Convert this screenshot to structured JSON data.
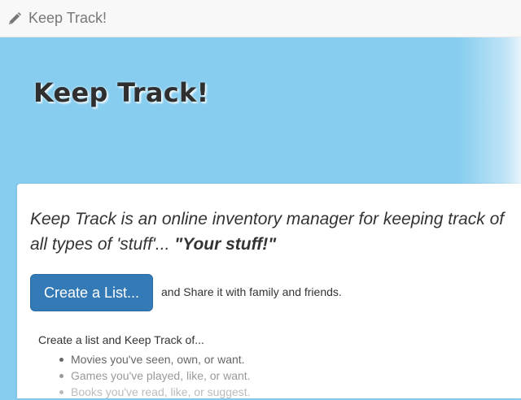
{
  "navbar": {
    "brand_icon": "pencil-icon",
    "brand_label": "Keep Track!"
  },
  "hero": {
    "title": "Keep Track!"
  },
  "panel": {
    "lead_part1": "Keep Track is an online inventory manager for keeping track of all types of 'stuff'... ",
    "lead_emphasis": "\"Your stuff!\"",
    "create_button_label": "Create a List...",
    "share_text": "and Share it with family and friends.",
    "list_intro": "Create a list and Keep Track of...",
    "list_items": [
      "Movies you've seen, own, or want.",
      "Games you've played, like, or want.",
      "Books you've read, like, or suggest."
    ]
  },
  "colors": {
    "hero_background": "#87cdef",
    "primary_button": "#337ab7",
    "navbar_background": "#f8f8f8"
  }
}
